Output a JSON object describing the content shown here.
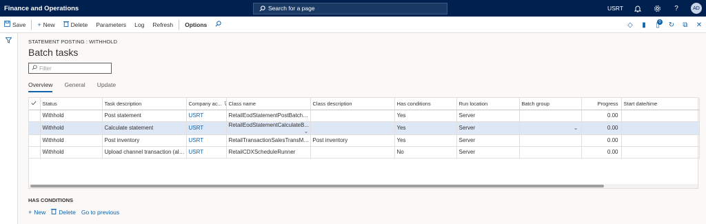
{
  "app_title": "Finance and Operations",
  "search": {
    "placeholder": "Search for a page"
  },
  "top_right": {
    "company": "USRT",
    "avatar": "AD"
  },
  "actions": {
    "save": "Save",
    "new": "New",
    "delete": "Delete",
    "parameters": "Parameters",
    "log": "Log",
    "refresh": "Refresh",
    "options": "Options"
  },
  "notification_badge": "0",
  "breadcrumb": "STATEMENT POSTING : WITHHOLD",
  "page_title": "Batch tasks",
  "filter": {
    "placeholder": "Filter"
  },
  "tabs": [
    "Overview",
    "General",
    "Update"
  ],
  "grid": {
    "headers": [
      "Status",
      "Task description",
      "Company ac...",
      "Class name",
      "Class description",
      "Has conditions",
      "Run location",
      "Batch group",
      "Progress",
      "Start date/time"
    ],
    "rows": [
      [
        "Withhold",
        "Post statement",
        "USRT",
        "RetailEodStatementPostBatchSc...",
        "",
        "Yes",
        "Server",
        "",
        "0.00",
        ""
      ],
      [
        "Withhold",
        "Calculate statement",
        "USRT",
        "RetailEodStatementCalculateB...",
        "",
        "Yes",
        "Server",
        "",
        "0.00",
        ""
      ],
      [
        "Withhold",
        "Post inventory",
        "USRT",
        "RetailTransactionSalesTransMark...",
        "Post inventory",
        "Yes",
        "Server",
        "",
        "0.00",
        ""
      ],
      [
        "Withhold",
        "Upload channel transaction (als...",
        "USRT",
        "RetailCDXScheduleRunner",
        "",
        "No",
        "Server",
        "",
        "0.00",
        ""
      ]
    ]
  },
  "has_conditions": {
    "title": "HAS CONDITIONS",
    "new": "New",
    "delete": "Delete",
    "go_to_previous": "Go to previous"
  }
}
